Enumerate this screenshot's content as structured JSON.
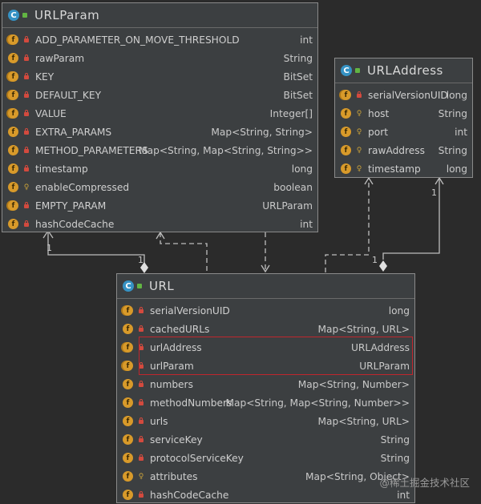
{
  "classes": {
    "urlparam": {
      "name": "URLParam",
      "fields": [
        {
          "icon": "static-final-field-icon",
          "vis": "private",
          "name": "ADD_PARAMETER_ON_MOVE_THRESHOLD",
          "type": "int"
        },
        {
          "icon": "field-icon",
          "vis": "private",
          "name": "rawParam",
          "type": "String"
        },
        {
          "icon": "static-final-field-icon",
          "vis": "private",
          "name": "KEY",
          "type": "BitSet"
        },
        {
          "icon": "static-final-field-icon",
          "vis": "private",
          "name": "DEFAULT_KEY",
          "type": "BitSet"
        },
        {
          "icon": "static-final-field-icon",
          "vis": "private",
          "name": "VALUE",
          "type": "Integer[]"
        },
        {
          "icon": "field-icon",
          "vis": "private",
          "name": "EXTRA_PARAMS",
          "type": "Map<String, String>"
        },
        {
          "icon": "field-icon",
          "vis": "private",
          "name": "METHOD_PARAMETERS",
          "type": "Map<String, Map<String, String>>"
        },
        {
          "icon": "field-icon",
          "vis": "private",
          "name": "timestamp",
          "type": "long"
        },
        {
          "icon": "field-icon",
          "vis": "protected",
          "name": "enableCompressed",
          "type": "boolean"
        },
        {
          "icon": "static-final-field-icon",
          "vis": "private",
          "name": "EMPTY_PARAM",
          "type": "URLParam"
        },
        {
          "icon": "field-icon",
          "vis": "private",
          "name": "hashCodeCache",
          "type": "int"
        }
      ]
    },
    "urladdress": {
      "name": "URLAddress",
      "fields": [
        {
          "icon": "static-final-field-icon",
          "vis": "private",
          "name": "serialVersionUID",
          "type": "long"
        },
        {
          "icon": "field-icon",
          "vis": "protected",
          "name": "host",
          "type": "String"
        },
        {
          "icon": "field-icon",
          "vis": "protected",
          "name": "port",
          "type": "int"
        },
        {
          "icon": "field-icon",
          "vis": "protected",
          "name": "rawAddress",
          "type": "String"
        },
        {
          "icon": "field-icon",
          "vis": "protected",
          "name": "timestamp",
          "type": "long"
        }
      ]
    },
    "url": {
      "name": "URL",
      "fields": [
        {
          "icon": "static-final-field-icon",
          "vis": "private",
          "name": "serialVersionUID",
          "type": "long"
        },
        {
          "icon": "field-icon",
          "vis": "private",
          "name": "cachedURLs",
          "type": "Map<String, URL>"
        },
        {
          "icon": "static-final-field-icon",
          "vis": "private",
          "name": "urlAddress",
          "type": "URLAddress"
        },
        {
          "icon": "static-final-field-icon",
          "vis": "private",
          "name": "urlParam",
          "type": "URLParam"
        },
        {
          "icon": "field-icon",
          "vis": "private",
          "name": "numbers",
          "type": "Map<String, Number>"
        },
        {
          "icon": "field-icon",
          "vis": "private",
          "name": "methodNumbers",
          "type": "Map<String, Map<String, Number>>"
        },
        {
          "icon": "field-icon",
          "vis": "private",
          "name": "urls",
          "type": "Map<String, URL>"
        },
        {
          "icon": "field-icon",
          "vis": "private",
          "name": "serviceKey",
          "type": "String"
        },
        {
          "icon": "field-icon",
          "vis": "private",
          "name": "protocolServiceKey",
          "type": "String"
        },
        {
          "icon": "field-icon",
          "vis": "protected",
          "name": "attributes",
          "type": "Map<String, Object>"
        },
        {
          "icon": "field-icon",
          "vis": "private",
          "name": "hashCodeCache",
          "type": "int"
        }
      ]
    }
  },
  "multiplicities": {
    "urlparam_side": "1",
    "url_side_left": "1",
    "urladdress_side": "1",
    "url_side_right": "1"
  },
  "watermark": "@稀土掘金技术社区",
  "colors": {
    "background": "#2b2b2b",
    "box": "#3c3f41",
    "highlight": "#c0262d",
    "class_icon": "#3592c4",
    "field_icon": "#d89a2a",
    "private_lock": "#d34a3e"
  }
}
